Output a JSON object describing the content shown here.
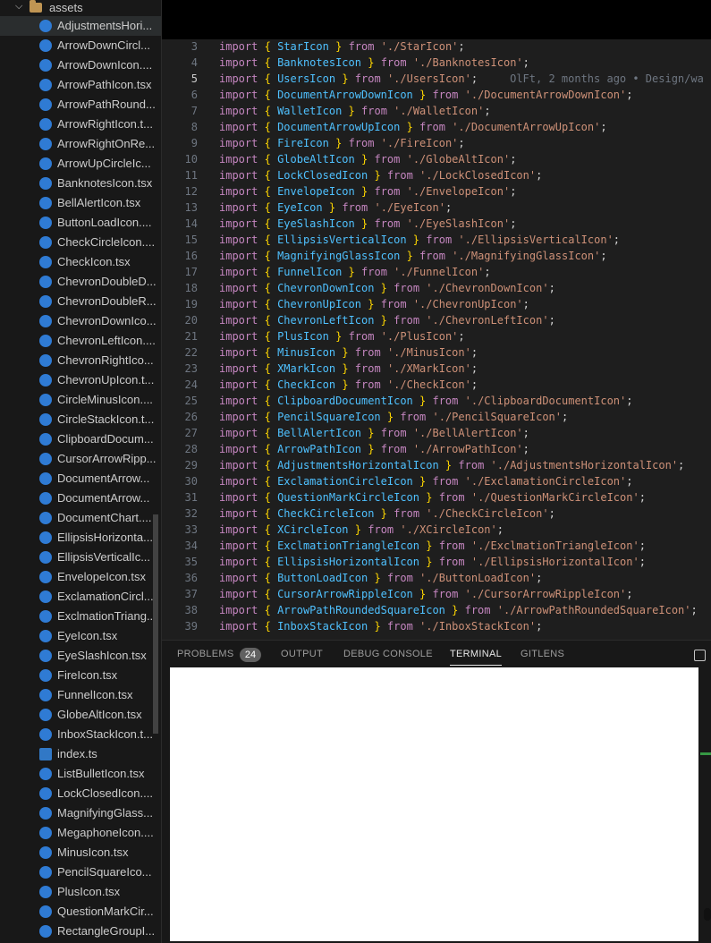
{
  "explorer": {
    "folder": {
      "name": "assets"
    },
    "files": [
      {
        "name": "AdjustmentsHori...",
        "type": "tsx",
        "active": true
      },
      {
        "name": "ArrowDownCircl...",
        "type": "tsx"
      },
      {
        "name": "ArrowDownIcon....",
        "type": "tsx"
      },
      {
        "name": "ArrowPathIcon.tsx",
        "type": "tsx"
      },
      {
        "name": "ArrowPathRound...",
        "type": "tsx"
      },
      {
        "name": "ArrowRightIcon.t...",
        "type": "tsx"
      },
      {
        "name": "ArrowRightOnRe...",
        "type": "tsx"
      },
      {
        "name": "ArrowUpCircleIc...",
        "type": "tsx"
      },
      {
        "name": "BanknotesIcon.tsx",
        "type": "tsx"
      },
      {
        "name": "BellAlertIcon.tsx",
        "type": "tsx"
      },
      {
        "name": "ButtonLoadIcon....",
        "type": "tsx"
      },
      {
        "name": "CheckCircleIcon....",
        "type": "tsx"
      },
      {
        "name": "CheckIcon.tsx",
        "type": "tsx"
      },
      {
        "name": "ChevronDoubleD...",
        "type": "tsx"
      },
      {
        "name": "ChevronDoubleR...",
        "type": "tsx"
      },
      {
        "name": "ChevronDownIco...",
        "type": "tsx"
      },
      {
        "name": "ChevronLeftIcon....",
        "type": "tsx"
      },
      {
        "name": "ChevronRightIco...",
        "type": "tsx"
      },
      {
        "name": "ChevronUpIcon.t...",
        "type": "tsx"
      },
      {
        "name": "CircleMinusIcon....",
        "type": "tsx"
      },
      {
        "name": "CircleStackIcon.t...",
        "type": "tsx"
      },
      {
        "name": "ClipboardDocum...",
        "type": "tsx"
      },
      {
        "name": "CursorArrowRipp...",
        "type": "tsx"
      },
      {
        "name": "DocumentArrow...",
        "type": "tsx"
      },
      {
        "name": "DocumentArrow...",
        "type": "tsx"
      },
      {
        "name": "DocumentChart....",
        "type": "tsx"
      },
      {
        "name": "EllipsisHorizonta...",
        "type": "tsx"
      },
      {
        "name": "EllipsisVerticalIc...",
        "type": "tsx"
      },
      {
        "name": "EnvelopeIcon.tsx",
        "type": "tsx"
      },
      {
        "name": "ExclamationCircl...",
        "type": "tsx"
      },
      {
        "name": "ExclmationTriang...",
        "type": "tsx"
      },
      {
        "name": "EyeIcon.tsx",
        "type": "tsx"
      },
      {
        "name": "EyeSlashIcon.tsx",
        "type": "tsx"
      },
      {
        "name": "FireIcon.tsx",
        "type": "tsx"
      },
      {
        "name": "FunnelIcon.tsx",
        "type": "tsx"
      },
      {
        "name": "GlobeAltIcon.tsx",
        "type": "tsx"
      },
      {
        "name": "InboxStackIcon.t...",
        "type": "tsx"
      },
      {
        "name": "index.ts",
        "type": "ts"
      },
      {
        "name": "ListBulletIcon.tsx",
        "type": "tsx"
      },
      {
        "name": "LockClosedIcon....",
        "type": "tsx"
      },
      {
        "name": "MagnifyingGlass...",
        "type": "tsx"
      },
      {
        "name": "MegaphoneIcon....",
        "type": "tsx"
      },
      {
        "name": "MinusIcon.tsx",
        "type": "tsx"
      },
      {
        "name": "PencilSquareIco...",
        "type": "tsx"
      },
      {
        "name": "PlusIcon.tsx",
        "type": "tsx"
      },
      {
        "name": "QuestionMarkCir...",
        "type": "tsx"
      },
      {
        "name": "RectangleGroupI...",
        "type": "tsx"
      }
    ]
  },
  "editor": {
    "keyword_import": "import",
    "keyword_from": "from",
    "blame": "OlFt, 2 months ago • Design/wa",
    "current_line": 5,
    "lines": [
      {
        "n": "3",
        "name": "StarIcon",
        "path": "'./StarIcon'"
      },
      {
        "n": "4",
        "name": "BanknotesIcon",
        "path": "'./BanknotesIcon'"
      },
      {
        "n": "5",
        "name": "UsersIcon",
        "path": "'./UsersIcon'"
      },
      {
        "n": "6",
        "name": "DocumentArrowDownIcon",
        "path": "'./DocumentArrowDownIcon'"
      },
      {
        "n": "7",
        "name": "WalletIcon",
        "path": "'./WalletIcon'"
      },
      {
        "n": "8",
        "name": "DocumentArrowUpIcon",
        "path": "'./DocumentArrowUpIcon'"
      },
      {
        "n": "9",
        "name": "FireIcon",
        "path": "'./FireIcon'"
      },
      {
        "n": "10",
        "name": "GlobeAltIcon",
        "path": "'./GlobeAltIcon'"
      },
      {
        "n": "11",
        "name": "LockClosedIcon",
        "path": "'./LockClosedIcon'"
      },
      {
        "n": "12",
        "name": "EnvelopeIcon",
        "path": "'./EnvelopeIcon'"
      },
      {
        "n": "13",
        "name": "EyeIcon",
        "path": "'./EyeIcon'"
      },
      {
        "n": "14",
        "name": "EyeSlashIcon",
        "path": "'./EyeSlashIcon'"
      },
      {
        "n": "15",
        "name": "EllipsisVerticalIcon",
        "path": "'./EllipsisVerticalIcon'"
      },
      {
        "n": "16",
        "name": "MagnifyingGlassIcon",
        "path": "'./MagnifyingGlassIcon'"
      },
      {
        "n": "17",
        "name": "FunnelIcon",
        "path": "'./FunnelIcon'"
      },
      {
        "n": "18",
        "name": "ChevronDownIcon",
        "path": "'./ChevronDownIcon'"
      },
      {
        "n": "19",
        "name": "ChevronUpIcon",
        "path": "'./ChevronUpIcon'"
      },
      {
        "n": "20",
        "name": "ChevronLeftIcon",
        "path": "'./ChevronLeftIcon'"
      },
      {
        "n": "21",
        "name": "PlusIcon",
        "path": "'./PlusIcon'"
      },
      {
        "n": "22",
        "name": "MinusIcon",
        "path": "'./MinusIcon'"
      },
      {
        "n": "23",
        "name": "XMarkIcon",
        "path": "'./XMarkIcon'"
      },
      {
        "n": "24",
        "name": "CheckIcon",
        "path": "'./CheckIcon'"
      },
      {
        "n": "25",
        "name": "ClipboardDocumentIcon",
        "path": "'./ClipboardDocumentIcon'"
      },
      {
        "n": "26",
        "name": "PencilSquareIcon",
        "path": "'./PencilSquareIcon'"
      },
      {
        "n": "27",
        "name": "BellAlertIcon",
        "path": "'./BellAlertIcon'"
      },
      {
        "n": "28",
        "name": "ArrowPathIcon",
        "path": "'./ArrowPathIcon'"
      },
      {
        "n": "29",
        "name": "AdjustmentsHorizontalIcon",
        "path": "'./AdjustmentsHorizontalIcon'"
      },
      {
        "n": "30",
        "name": "ExclamationCircleIcon",
        "path": "'./ExclamationCircleIcon'"
      },
      {
        "n": "31",
        "name": "QuestionMarkCircleIcon",
        "path": "'./QuestionMarkCircleIcon'"
      },
      {
        "n": "32",
        "name": "CheckCircleIcon",
        "path": "'./CheckCircleIcon'"
      },
      {
        "n": "33",
        "name": "XCircleIcon",
        "path": "'./XCircleIcon'"
      },
      {
        "n": "34",
        "name": "ExclmationTriangleIcon",
        "path": "'./ExclmationTriangleIcon'"
      },
      {
        "n": "35",
        "name": "EllipsisHorizontalIcon",
        "path": "'./EllipsisHorizontalIcon'"
      },
      {
        "n": "36",
        "name": "ButtonLoadIcon",
        "path": "'./ButtonLoadIcon'"
      },
      {
        "n": "37",
        "name": "CursorArrowRippleIcon",
        "path": "'./CursorArrowRippleIcon'"
      },
      {
        "n": "38",
        "name": "ArrowPathRoundedSquareIcon",
        "path": "'./ArrowPathRoundedSquareIcon'"
      },
      {
        "n": "39",
        "name": "InboxStackIcon",
        "path": "'./InboxStackIcon'"
      }
    ]
  },
  "panel": {
    "tabs": [
      {
        "label": "PROBLEMS",
        "active": false
      },
      {
        "label": "OUTPUT",
        "active": false
      },
      {
        "label": "DEBUG CONSOLE",
        "active": false
      },
      {
        "label": "TERMINAL",
        "active": true
      },
      {
        "label": "GITLENS",
        "active": false
      }
    ],
    "problems_count": "24"
  },
  "colors": {
    "keyword": "#c586c0",
    "identifier": "#4fc1ff",
    "string": "#ce9178",
    "bracket": "#ffd700",
    "file_icon": "#2f7bd4"
  }
}
